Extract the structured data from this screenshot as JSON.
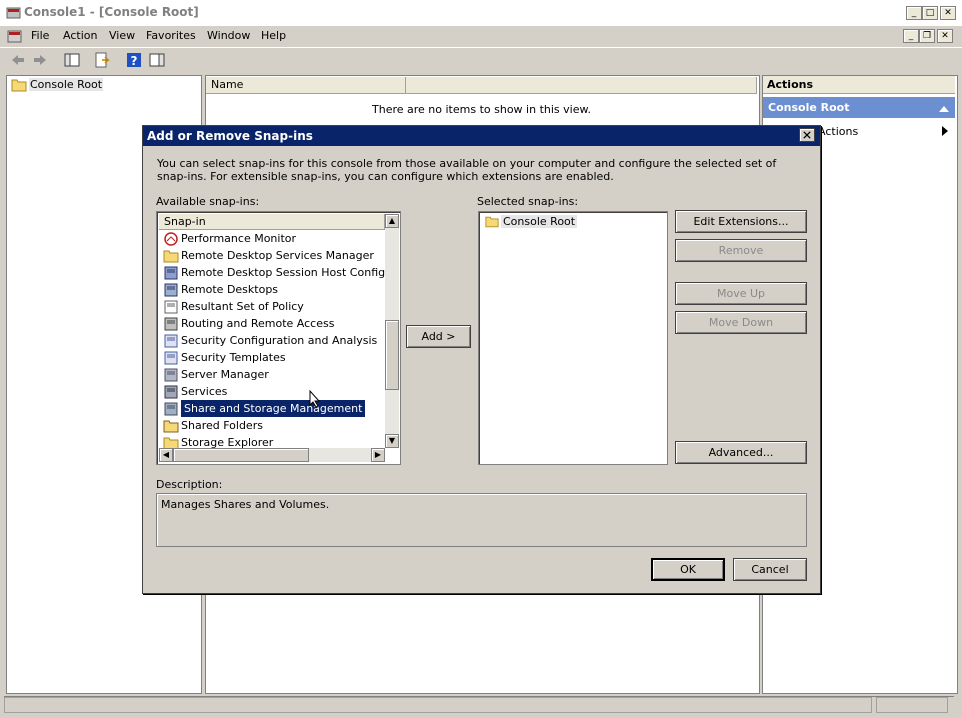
{
  "window": {
    "title": "Console1 - [Console Root]",
    "controls": [
      "_",
      "□",
      "✕"
    ],
    "mdi_controls": [
      "_",
      "❐",
      "✕"
    ]
  },
  "menu": [
    "File",
    "Action",
    "View",
    "Favorites",
    "Window",
    "Help"
  ],
  "tree": {
    "root_label": "Console Root"
  },
  "list": {
    "column_name": "Name",
    "empty_text": "There are no items to show in this view."
  },
  "actions": {
    "header": "Actions",
    "section": "Console Root",
    "more_actions": "Actions"
  },
  "dialog": {
    "title": "Add or Remove Snap-ins",
    "intro": "You can select snap-ins for this console from those available on your computer and configure the selected set of snap-ins. For extensible snap-ins, you can configure which extensions are enabled.",
    "available_label": "Available snap-ins:",
    "available_column": "Snap-in",
    "available_items": [
      {
        "label": "Performance Monitor",
        "icon": "perf-monitor-icon"
      },
      {
        "label": "Remote Desktop Services Manager",
        "icon": "folder-icon"
      },
      {
        "label": "Remote Desktop Session Host Configuratic",
        "icon": "rdsh-config-icon"
      },
      {
        "label": "Remote Desktops",
        "icon": "remote-desktops-icon"
      },
      {
        "label": "Resultant Set of Policy",
        "icon": "policy-icon"
      },
      {
        "label": "Routing and Remote Access",
        "icon": "routing-icon"
      },
      {
        "label": "Security Configuration and Analysis",
        "icon": "security-config-icon"
      },
      {
        "label": "Security Templates",
        "icon": "security-templates-icon"
      },
      {
        "label": "Server Manager",
        "icon": "server-manager-icon"
      },
      {
        "label": "Services",
        "icon": "services-icon"
      },
      {
        "label": "Share and Storage Management",
        "icon": "storage-icon",
        "selected": true
      },
      {
        "label": "Shared Folders",
        "icon": "shared-folders-icon"
      },
      {
        "label": "Storage Explorer",
        "icon": "folder-icon"
      }
    ],
    "add_button": "Add >",
    "selected_label": "Selected snap-ins:",
    "selected_items": [
      "Console Root"
    ],
    "buttons": {
      "edit_extensions": "Edit Extensions...",
      "remove": "Remove",
      "move_up": "Move Up",
      "move_down": "Move Down",
      "advanced": "Advanced..."
    },
    "description_label": "Description:",
    "description_text": "Manages Shares and Volumes.",
    "ok": "OK",
    "cancel": "Cancel"
  },
  "colors": {
    "selection": "#0a246a",
    "actions_section": "#6b8fd0",
    "face": "#d4d0c8"
  }
}
